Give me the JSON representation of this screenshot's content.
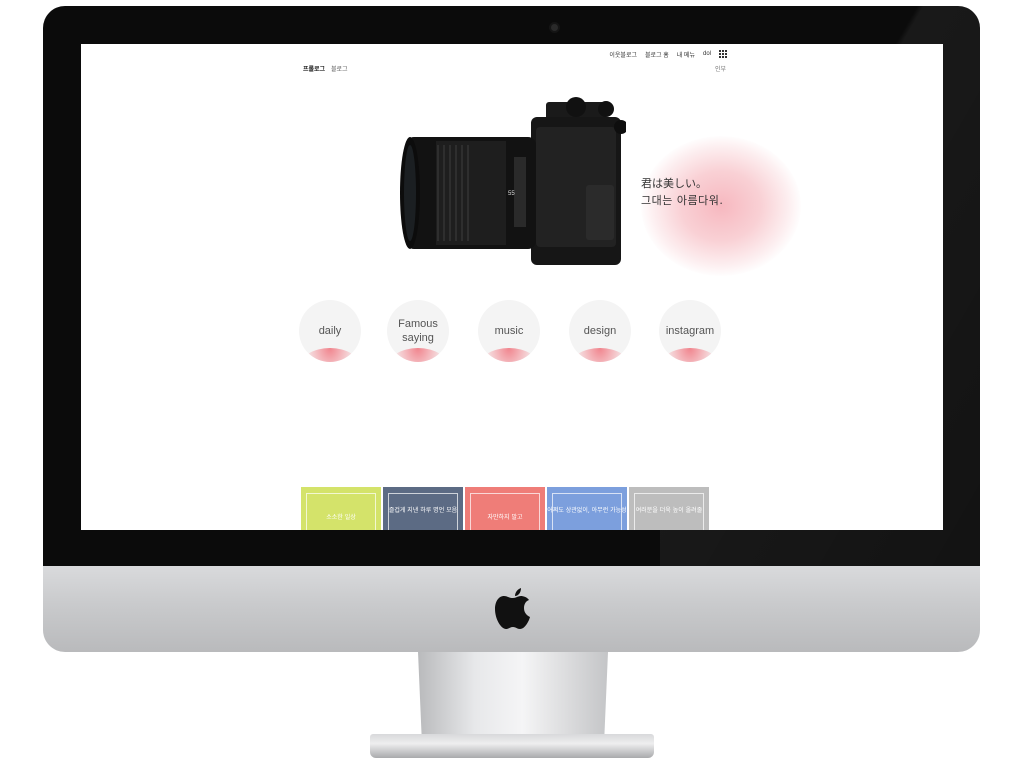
{
  "topbar": {
    "links": [
      "이웃블로그",
      "블로그 홈",
      "내 메뉴",
      "dol"
    ]
  },
  "blog": {
    "title": "프롤로그",
    "subtitle": "블로그",
    "menu_link": "인부"
  },
  "hero": {
    "quote_line1": "君は美しい。",
    "quote_line2": "그대는 아름다워."
  },
  "categories": [
    {
      "label": "daily"
    },
    {
      "label": "Famous saying"
    },
    {
      "label": "music"
    },
    {
      "label": "design"
    },
    {
      "label": "instagram"
    }
  ],
  "cards": [
    {
      "color": "#d4e36a",
      "text": "소소한 일상"
    },
    {
      "color": "#5c6b84",
      "text": "즐겁게 지낸 하루 명언 모음"
    },
    {
      "color": "#ef7d78",
      "text": "자만하지 말고"
    },
    {
      "color": "#7c9fdd",
      "text": "어쩌도 상관없이, 아무런 가능성"
    },
    {
      "color": "#bdbdbd",
      "text": "여러분을 더욱 높이 올려줄"
    }
  ],
  "colors": {
    "accent_pink": "#f4a0aa",
    "bezel": "#0b0b0b"
  }
}
